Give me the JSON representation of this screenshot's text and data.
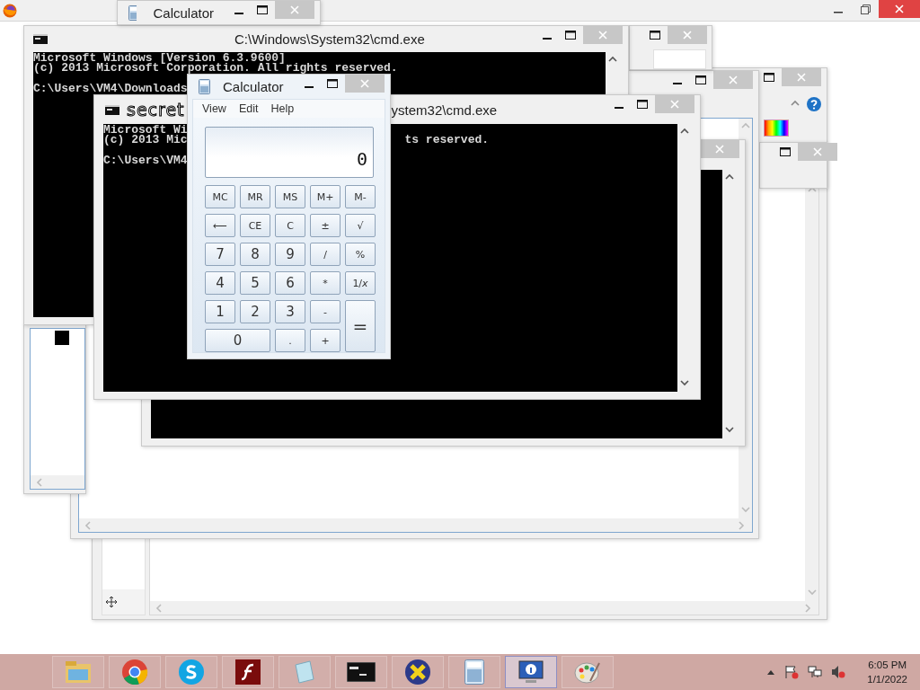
{
  "calculator_behind": {
    "title": "Calculator"
  },
  "console_back": {
    "title": "C:\\Windows\\System32\\cmd.exe",
    "lines": [
      "Microsoft Windows [Version 6.3.9600]",
      "(c) 2013 Microsoft Corporation. All rights reserved.",
      "C:\\Users\\VM4\\Downloads"
    ]
  },
  "console_front": {
    "overlay_label": "secret",
    "title_fragment": "ystem32\\cmd.exe",
    "lines": [
      "Microsoft Wi",
      "(c) 2013 Mic",
      "C:\\Users\\VM4"
    ],
    "line_right": "ts reserved."
  },
  "calculator": {
    "title": "Calculator",
    "menu": [
      "View",
      "Edit",
      "Help"
    ],
    "display": "0",
    "keys": [
      {
        "label": "MC",
        "kind": "memory"
      },
      {
        "label": "MR",
        "kind": "memory"
      },
      {
        "label": "MS",
        "kind": "memory"
      },
      {
        "label": "M+",
        "kind": "memory"
      },
      {
        "label": "M-",
        "kind": "memory"
      },
      {
        "label": "⟵",
        "kind": "function"
      },
      {
        "label": "CE",
        "kind": "function"
      },
      {
        "label": "C",
        "kind": "function"
      },
      {
        "label": "±",
        "kind": "function"
      },
      {
        "label": "√",
        "kind": "function"
      },
      {
        "label": "7",
        "kind": "digit"
      },
      {
        "label": "8",
        "kind": "digit"
      },
      {
        "label": "9",
        "kind": "digit"
      },
      {
        "label": "/",
        "kind": "function"
      },
      {
        "label": "%",
        "kind": "function"
      },
      {
        "label": "4",
        "kind": "digit"
      },
      {
        "label": "5",
        "kind": "digit"
      },
      {
        "label": "6",
        "kind": "digit"
      },
      {
        "label": "*",
        "kind": "function"
      },
      {
        "label": "1/*x*",
        "kind": "function"
      },
      {
        "label": "1",
        "kind": "digit"
      },
      {
        "label": "2",
        "kind": "digit"
      },
      {
        "label": "3",
        "kind": "digit"
      },
      {
        "label": "-",
        "kind": "function"
      },
      {
        "label": "=",
        "kind": "equals"
      },
      {
        "label": "0",
        "kind": "zero"
      },
      {
        "label": ".",
        "kind": "function"
      },
      {
        "label": "+",
        "kind": "function"
      }
    ]
  },
  "taskbar": {
    "apps": [
      {
        "kind": "folder",
        "selected": false
      },
      {
        "kind": "chrome",
        "selected": false
      },
      {
        "kind": "skype",
        "selected": false
      },
      {
        "kind": "flash",
        "selected": false
      },
      {
        "kind": "notepad",
        "selected": false
      },
      {
        "kind": "console",
        "selected": false
      },
      {
        "kind": "cross",
        "selected": false
      },
      {
        "kind": "calculator",
        "selected": false
      },
      {
        "kind": "monitor",
        "selected": true
      },
      {
        "kind": "palette",
        "selected": false
      }
    ],
    "clock": {
      "time": "6:05 PM",
      "date": "1/1/2022"
    }
  }
}
